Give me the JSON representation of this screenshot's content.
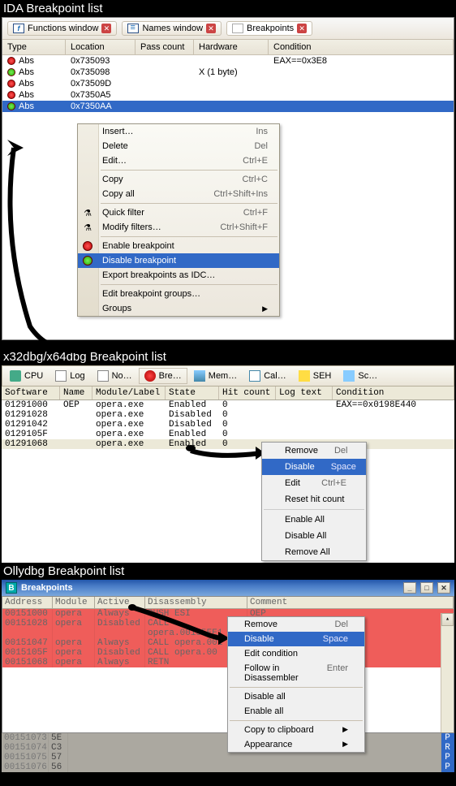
{
  "sections": {
    "ida": "IDA Breakpoint list",
    "x64": "x32dbg/x64dbg Breakpoint list",
    "olly": "Ollydbg Breakpoint list"
  },
  "ida": {
    "tabs": [
      {
        "label": "Functions window",
        "icon": "fx"
      },
      {
        "label": "Names window",
        "icon": "names"
      },
      {
        "label": "Breakpoints",
        "icon": "bp",
        "active": true
      }
    ],
    "cols": {
      "type": "Type",
      "location": "Location",
      "pass": "Pass count",
      "hw": "Hardware",
      "cond": "Condition"
    },
    "rows": [
      {
        "dot": "red",
        "type": "Abs",
        "loc": "0x735093",
        "pass": "",
        "hw": "",
        "cond": "EAX==0x3E8"
      },
      {
        "dot": "green",
        "type": "Abs",
        "loc": "0x735098",
        "pass": "",
        "hw": "X (1 byte)",
        "cond": ""
      },
      {
        "dot": "red",
        "type": "Abs",
        "loc": "0x73509D",
        "pass": "",
        "hw": "",
        "cond": ""
      },
      {
        "dot": "red",
        "type": "Abs",
        "loc": "0x7350A5",
        "pass": "",
        "hw": "",
        "cond": ""
      },
      {
        "dot": "green",
        "type": "Abs",
        "loc": "0x7350AA",
        "pass": "",
        "hw": "",
        "cond": "",
        "sel": true
      }
    ],
    "menu": [
      {
        "label": "Insert…",
        "key": "Ins"
      },
      {
        "label": "Delete",
        "key": "Del"
      },
      {
        "label": "Edit…",
        "key": "Ctrl+E"
      },
      {
        "sep": true
      },
      {
        "label": "Copy",
        "key": "Ctrl+C"
      },
      {
        "label": "Copy all",
        "key": "Ctrl+Shift+Ins"
      },
      {
        "sep": true
      },
      {
        "label": "Quick filter",
        "key": "Ctrl+F",
        "icon": "filter"
      },
      {
        "label": "Modify filters…",
        "key": "Ctrl+Shift+F",
        "icon": "filter2"
      },
      {
        "sep": true
      },
      {
        "label": "Enable breakpoint",
        "icon": "enable"
      },
      {
        "label": "Disable breakpoint",
        "icon": "disable",
        "sel": true
      },
      {
        "label": "Export breakpoints as IDC…"
      },
      {
        "sep": true
      },
      {
        "label": "Edit breakpoint groups…"
      },
      {
        "label": "Groups",
        "sub": true
      }
    ]
  },
  "x64": {
    "toolbar": [
      {
        "label": "CPU",
        "icon": "cpu"
      },
      {
        "label": "Log",
        "icon": "log"
      },
      {
        "label": "No…",
        "icon": "notes"
      },
      {
        "label": "Bre…",
        "icon": "bre",
        "active": true
      },
      {
        "label": "Mem…",
        "icon": "mem"
      },
      {
        "label": "Cal…",
        "icon": "cal"
      },
      {
        "label": "SEH",
        "icon": "seh"
      },
      {
        "label": "Sc…",
        "icon": "sc"
      }
    ],
    "cols": {
      "soft": "Software",
      "name": "Name",
      "mod": "Module/Label",
      "state": "State",
      "hit": "Hit count",
      "log": "Log text",
      "cond": "Condition"
    },
    "rows": [
      {
        "addr": "01291000",
        "name": "OEP",
        "mod": "opera.exe",
        "state": "Enabled",
        "hit": "0",
        "cond": "EAX==0x0198E440"
      },
      {
        "addr": "01291028",
        "name": "",
        "mod": "opera.exe",
        "state": "Disabled",
        "hit": "0",
        "cond": ""
      },
      {
        "addr": "01291042",
        "name": "",
        "mod": "opera.exe",
        "state": "Disabled",
        "hit": "0",
        "cond": ""
      },
      {
        "addr": "0129105F",
        "name": "",
        "mod": "opera.exe",
        "state": "Enabled",
        "hit": "0",
        "cond": ""
      },
      {
        "addr": "01291068",
        "name": "",
        "mod": "opera.exe",
        "state": "Enabled",
        "hit": "0",
        "cond": "",
        "sel": true
      }
    ],
    "menu": [
      {
        "label": "Remove",
        "key": "Del"
      },
      {
        "label": "Disable",
        "key": "Space",
        "sel": true
      },
      {
        "label": "Edit",
        "key": "Ctrl+E"
      },
      {
        "label": "Reset hit count"
      },
      {
        "sep": true
      },
      {
        "label": "Enable All"
      },
      {
        "label": "Disable All"
      },
      {
        "label": "Remove All"
      }
    ]
  },
  "olly": {
    "title": "Breakpoints",
    "cols": {
      "addr": "Address",
      "mod": "Module",
      "act": "Active",
      "dis": "Disassembly",
      "com": "Comment"
    },
    "rows": [
      {
        "addr": "00151000",
        "mod": "opera",
        "act": "Always",
        "dis": "PUSH ESI",
        "com": "OEP"
      },
      {
        "addr": "00151028",
        "mod": "opera",
        "act": "Disabled",
        "dis": "CALL opera.00155EE1",
        "com": ""
      },
      {
        "addr": "00151047",
        "mod": "opera",
        "act": "Always",
        "dis": "CALL opera.001",
        "com": ""
      },
      {
        "addr": "0015105F",
        "mod": "opera",
        "act": "Disabled",
        "dis": "CALL opera.00",
        "com": ""
      },
      {
        "addr": "00151068",
        "mod": "opera",
        "act": "Always",
        "dis": "RETN",
        "com": ""
      }
    ],
    "dimrows": [
      {
        "addr": "00151073",
        "bytes": "5E",
        "dis": "P"
      },
      {
        "addr": "00151074",
        "bytes": "C3",
        "dis": "R"
      },
      {
        "addr": "00151075",
        "bytes": "57",
        "dis": "P"
      },
      {
        "addr": "00151076",
        "bytes": "56",
        "dis": "P"
      }
    ],
    "menu": [
      {
        "label": "Remove",
        "key": "Del"
      },
      {
        "label": "Disable",
        "key": "Space",
        "sel": true
      },
      {
        "label": "Edit condition"
      },
      {
        "label": "Follow in Disassembler",
        "key": "Enter"
      },
      {
        "sep": true
      },
      {
        "label": "Disable all"
      },
      {
        "label": "Enable all"
      },
      {
        "sep": true
      },
      {
        "label": "Copy to clipboard",
        "sub": true
      },
      {
        "label": "Appearance",
        "sub": true
      }
    ]
  }
}
